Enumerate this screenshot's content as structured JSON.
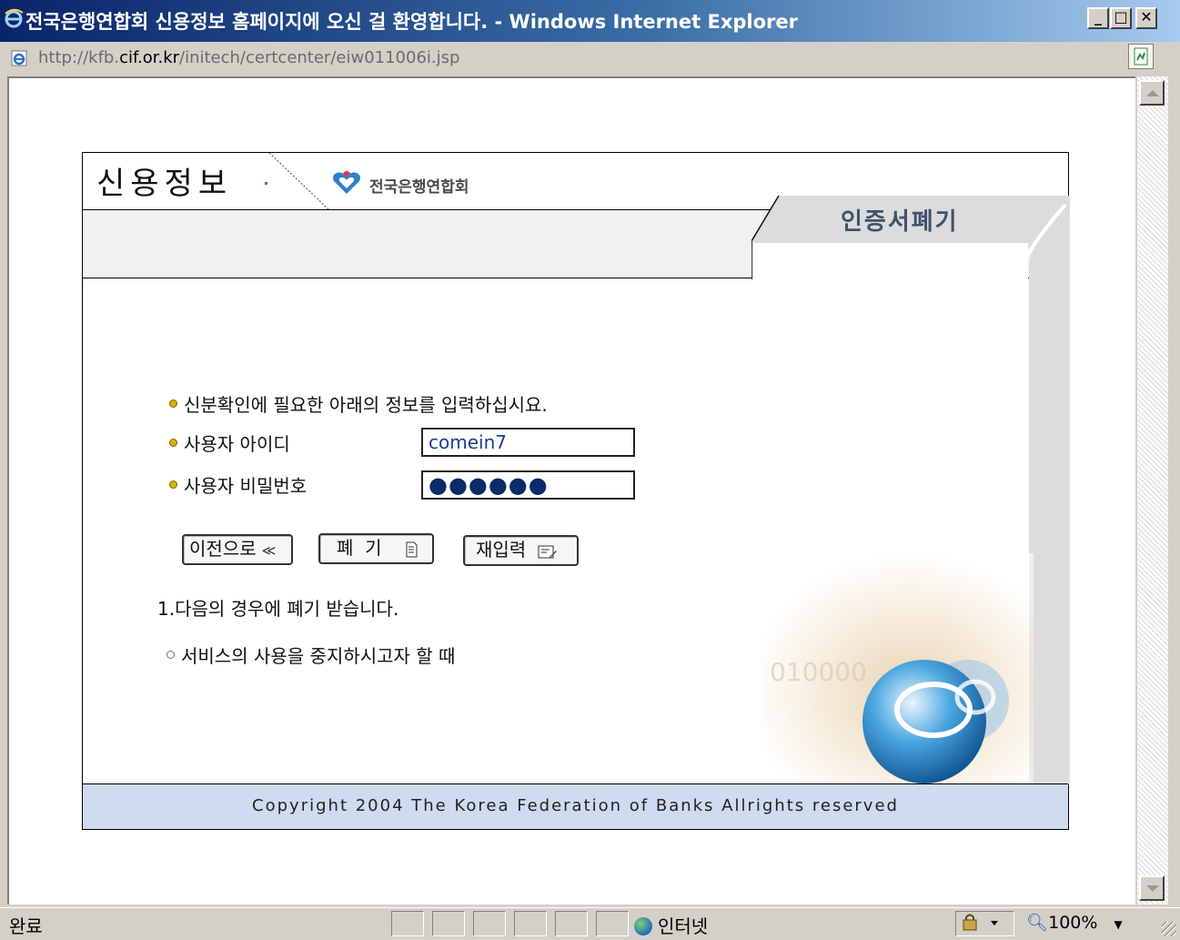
{
  "window": {
    "title": "전국은행연합회 신용정보 홈페이지에 오신 걸 환영합니다. - Windows Internet Explorer",
    "minimize": "_",
    "maximize": "□",
    "close": "✕"
  },
  "address": {
    "url_prefix": "http://kfb.",
    "url_host": "cif.or.kr",
    "url_path": "/initech/certcenter/eiw011006i.jsp"
  },
  "page": {
    "brand": "신용정보",
    "logo_text": "전국은행연합회",
    "tab_label": "인증서폐기",
    "instruction": "신분확인에 필요한 아래의 정보를 입력하십시요.",
    "user_id_label": "사용자 아이디",
    "user_id_value": "comein7",
    "password_label": "사용자 비밀번호",
    "password_value": "●●●●●●",
    "buttons": {
      "back": "이전으로",
      "back_icon": "≪",
      "revoke": "폐  기",
      "reset": "재입력"
    },
    "note_title": "1.다음의 경우에 폐기 받습니다.",
    "note_item": "서비스의 사용을 중지하시고자 할 때",
    "footer": "Copyright 2004 The Korea Federation of Banks Allrights reserved"
  },
  "status": {
    "text": "완료",
    "zone": "인터넷",
    "zoom": "100%"
  },
  "icons": [
    "ie-icon",
    "page-icon",
    "refresh-icon",
    "globe-icon",
    "zoom-icon",
    "lock-icon"
  ],
  "colors": {
    "titlebar_start": "#0a246a",
    "titlebar_end": "#a6caf0",
    "footer_band": "#cfdbef",
    "tab_text": "#3e536d",
    "bullet": "#d6b300"
  }
}
